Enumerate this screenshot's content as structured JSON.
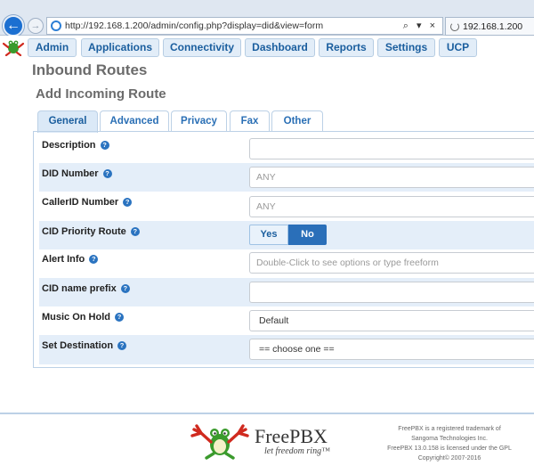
{
  "browser": {
    "address_url": "http://192.168.1.200/admin/config.php?display=did&view=form",
    "address_tools": "⌕ ▾ ×",
    "tab_title": "192.168.1.200"
  },
  "menu": {
    "items": [
      {
        "label": "Admin"
      },
      {
        "label": "Applications"
      },
      {
        "label": "Connectivity"
      },
      {
        "label": "Dashboard"
      },
      {
        "label": "Reports"
      },
      {
        "label": "Settings"
      },
      {
        "label": "UCP"
      }
    ]
  },
  "page": {
    "title": "Inbound Routes",
    "section_title": "Add Incoming Route"
  },
  "tabs": [
    {
      "label": "General",
      "active": true
    },
    {
      "label": "Advanced"
    },
    {
      "label": "Privacy"
    },
    {
      "label": "Fax"
    },
    {
      "label": "Other"
    }
  ],
  "form": {
    "help_glyph": "?",
    "rows": [
      {
        "label": "Description",
        "value": "",
        "placeholder": ""
      },
      {
        "label": "DID Number",
        "value": "",
        "placeholder": "ANY"
      },
      {
        "label": "CallerID Number",
        "value": "",
        "placeholder": "ANY"
      },
      {
        "label": "CID Priority Route",
        "options": [
          "Yes",
          "No"
        ],
        "selected": "No"
      },
      {
        "label": "Alert Info",
        "value": "",
        "placeholder": "Double-Click to see options or type freeform"
      },
      {
        "label": "CID name prefix",
        "value": "",
        "placeholder": ""
      },
      {
        "label": "Music On Hold",
        "selected": "Default"
      },
      {
        "label": "Set Destination",
        "selected": "== choose one =="
      }
    ]
  },
  "footer": {
    "brand": "FreePBX",
    "tagline": "let freedom ring™",
    "legal": [
      "FreePBX is a registered trademark of",
      "Sangoma Technologies Inc.",
      "FreePBX 13.0.158 is licensed under the GPL",
      "Copyright© 2007-2016"
    ]
  },
  "colors": {
    "accent": "#2a6fb9",
    "row_shade": "#e4eef9",
    "menu_button": "#e2edf8",
    "frog_green": "#3a9a2c",
    "frog_red": "#d02a1f"
  }
}
